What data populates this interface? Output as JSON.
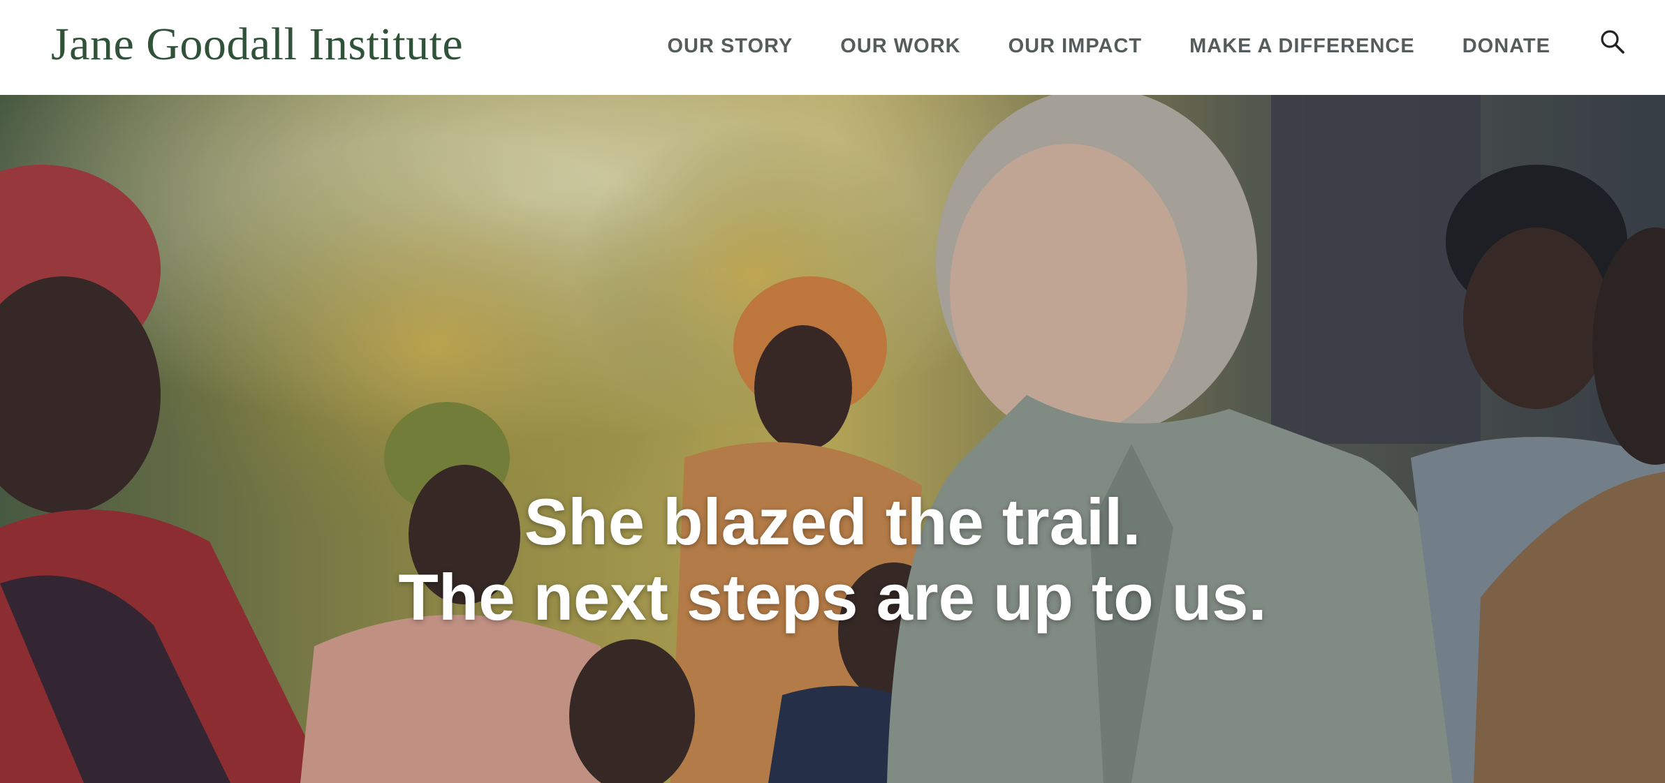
{
  "header": {
    "logo_text": "Jane Goodall Institute",
    "nav": [
      {
        "label": "OUR STORY"
      },
      {
        "label": "OUR WORK"
      },
      {
        "label": "OUR IMPACT"
      },
      {
        "label": "MAKE A DIFFERENCE"
      },
      {
        "label": "DONATE"
      }
    ],
    "search_icon": "search-icon"
  },
  "hero": {
    "line1": "She blazed the trail.",
    "line2": "The next steps are up to us."
  },
  "colors": {
    "logo_green": "#2f5238",
    "nav_gray": "#555c5c",
    "hero_text": "#ffffff"
  }
}
